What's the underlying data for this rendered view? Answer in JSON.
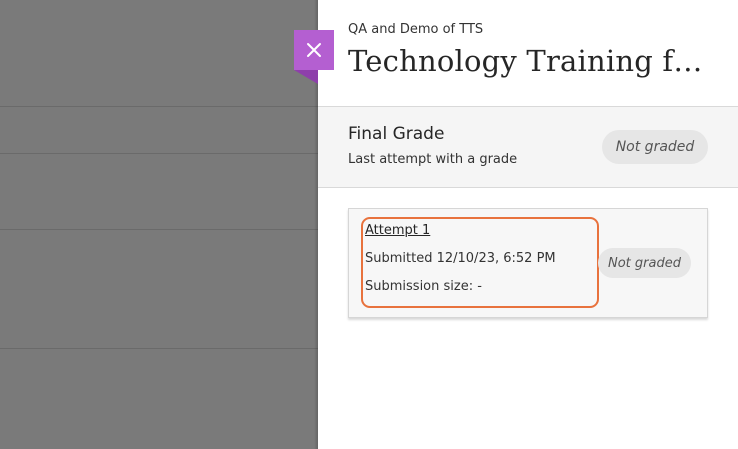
{
  "colors": {
    "accent": "#b45fd1",
    "highlight": "#e8723d",
    "backdrop": "#7a7a7a",
    "pill_bg": "#e6e6e6"
  },
  "header": {
    "breadcrumb": "QA and Demo of TTS",
    "title": "Technology Training fo…",
    "close_icon": "close-icon"
  },
  "final_grade": {
    "title": "Final Grade",
    "subtitle": "Last attempt with a grade",
    "status": "Not graded"
  },
  "attempt": {
    "label": "Attempt 1",
    "submitted": "Submitted 12/10/23, 6:52 PM",
    "size": "Submission size: -",
    "status": "Not graded"
  }
}
